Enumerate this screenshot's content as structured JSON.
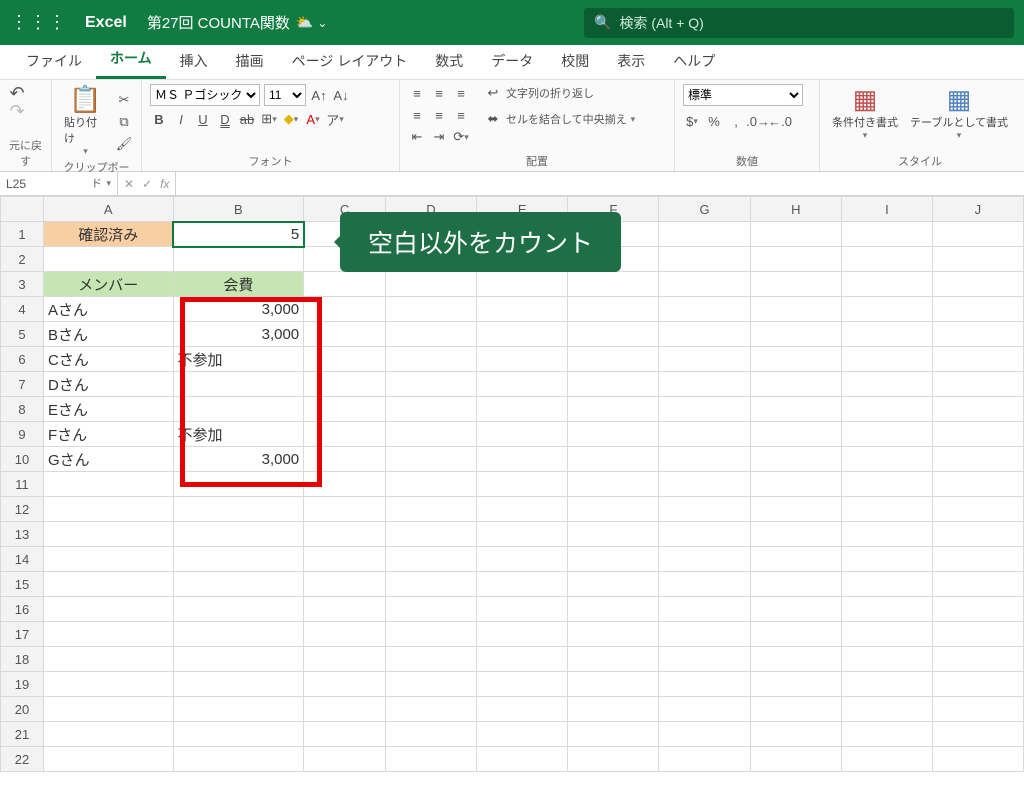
{
  "titlebar": {
    "app": "Excel",
    "document": "第27回 COUNTA関数",
    "search_placeholder": "検索 (Alt + Q)"
  },
  "tabs": {
    "file": "ファイル",
    "home": "ホーム",
    "insert": "挿入",
    "draw": "描画",
    "pagelayout": "ページ レイアウト",
    "formulas": "数式",
    "data": "データ",
    "review": "校閲",
    "view": "表示",
    "help": "ヘルプ"
  },
  "ribbon": {
    "undo_group": "元に戻す",
    "paste": "貼り付け",
    "clipboard": "クリップボード",
    "font_name": "ＭＳ Ｐゴシック (…",
    "font_size": "11",
    "font_group": "フォント",
    "wrap": "文字列の折り返し",
    "merge": "セルを結合して中央揃え",
    "align_group": "配置",
    "number_format": "標準",
    "number_group": "数値",
    "cond_format": "条件付き書式",
    "table_format": "テーブルとして書式",
    "style_group": "スタイル"
  },
  "namebox": "L25",
  "columns": [
    "A",
    "B",
    "C",
    "D",
    "E",
    "F",
    "G",
    "H",
    "I",
    "J"
  ],
  "rows": [
    "1",
    "2",
    "3",
    "4",
    "5",
    "6",
    "7",
    "8",
    "9",
    "10",
    "11",
    "12",
    "13",
    "14",
    "15",
    "16",
    "17",
    "18",
    "19",
    "20",
    "21",
    "22"
  ],
  "cells": {
    "A1": "確認済み",
    "B1": "5",
    "A3": "メンバー",
    "B3": "会費",
    "A4": "Aさん",
    "B4": "3,000",
    "A5": "Bさん",
    "B5": "3,000",
    "A6": "Cさん",
    "B6": "不参加",
    "A7": "Dさん",
    "B7": "",
    "A8": "Eさん",
    "B8": "",
    "A9": "Fさん",
    "B9": "不参加",
    "A10": "Gさん",
    "B10": "3,000"
  },
  "callout": "空白以外をカウント"
}
